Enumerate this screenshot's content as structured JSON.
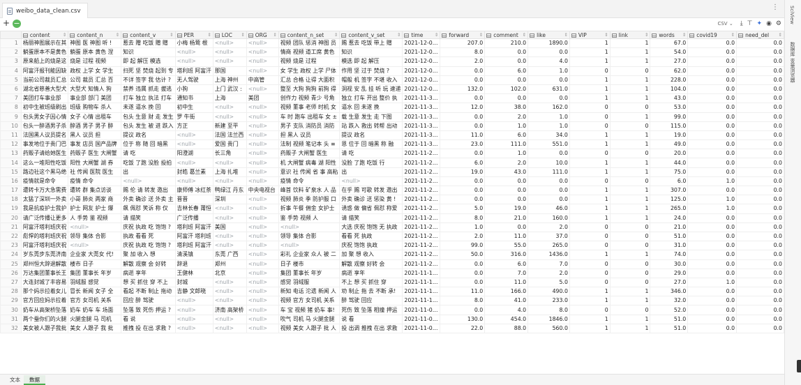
{
  "file_tab": {
    "name": "weibo_data_clean.csv"
  },
  "sidebar": {
    "label_1": "SciView",
    "label_2": "数据库 变量浏览器"
  },
  "toolbar": {
    "format": "CSV ⌄"
  },
  "columns": [
    "content",
    "content_n",
    "content_v",
    "PER",
    "LOC",
    "ORG",
    "content_n_set",
    "content_v_set",
    "time",
    "forward",
    "comment",
    "like",
    "VIP",
    "link",
    "words",
    "covid19",
    "need_del"
  ],
  "rows": [
    [
      "1",
      "杨丽神图展示在其",
      "神图 医 神图 听 !",
      "惹去 赠 吃饭 赠 赠",
      "小梅 杨莺 根",
      "<null>",
      "<null>",
      "视频 团队 惩消 神图 员",
      "赐 惹去 吃饭 带上 赠",
      "2021-12-0…",
      "207.0",
      "210.0",
      "1890.0",
      "1",
      "1",
      "67.0",
      "0.0",
      "0.0"
    ],
    [
      "2",
      "躺蛋原本不是黄色",
      "躺蛋 原本 黄色 涅",
      "知识",
      "<null>",
      "<null>",
      "<null>",
      "情商 视频 道工席 黄色",
      "知识",
      "2021-12-0…",
      "8.0",
      "0.0",
      "0.0",
      "1",
      "1",
      "54.0",
      "0.0",
      "0.0"
    ],
    [
      "3",
      "原来船上的烧是这",
      "烧是 过程 视频",
      "即 起 解压 模选",
      "<null>",
      "<null>",
      "<null>",
      "视频 烧是 过程",
      "模选 即 起 解压",
      "2021-12-0…",
      "2.0",
      "0.0",
      "4.0",
      "1",
      "1",
      "27.0",
      "0.0",
      "0.0"
    ],
    [
      "4",
      "阿富汗报刊能因缺",
      "政权 上学 女 学生",
      "扫死 坚 焚烧 起到 专",
      "塔利班 阿富汗",
      "那国",
      "<null>",
      "女 学生 政权 上学 尸体",
      "作用 坚 过于 焚烧 ?",
      "2021-12-0…",
      "0.0",
      "6.0",
      "1.0",
      "0",
      "0",
      "62.0",
      "0.0",
      "0.0"
    ],
    [
      "5",
      "当前公司裁员汇总",
      "公司 裁员 汇总 百",
      "不详 签字 我 估计 ?",
      "无人驾驶",
      "上海 神州",
      "中高管",
      "汇总 合格 让得 大面积",
      "帽般 机 签字 不堪 收入",
      "2021-12-0…",
      "0.0",
      "0.0",
      "0.0",
      "1",
      "1",
      "228.0",
      "0.0",
      "0.0"
    ],
    [
      "6",
      "湖北省慈善大型犬",
      "大型犬 知情人 狗",
      "禁养 违属 抓走 拔逃",
      "小狗",
      "上门 武汉 :",
      "<null>",
      "整至 大狗 狗狗 前狗 得",
      "洞视 安 乱 挂 听 玩 速递",
      "2021-12-0…",
      "132.0",
      "102.0",
      "631.0",
      "1",
      "1",
      "104.0",
      "0.0",
      "0.0"
    ],
    [
      "7",
      "美团打车事业部",
      "事业部 部门 美团",
      "打车 独立 执法 打车",
      "通知书",
      "上海",
      "美团",
      "创作力 视频 青少 号角",
      "独立 打车 开出 整价 执",
      "2021-11-3…",
      "0.0",
      "0.0",
      "0.0",
      "1",
      "1",
      "43.0",
      "0.0",
      "0.0"
    ],
    [
      "8",
      "初中生被班级刷出",
      "班级 购物车 杀人",
      "未遂 逼水 挽 回",
      "初中生",
      "<null>",
      "<null>",
      "视频 董事 老师 时机 女",
      "逼水 回 未遂 挽",
      "2021-11-3…",
      "12.0",
      "38.0",
      "162.0",
      "0",
      "0",
      "53.0",
      "0.0",
      "0.0"
    ],
    [
      "9",
      "包头男女子因心情",
      "女子 心情 出租车",
      "包头 生意 财 走 发生",
      "罗 牛街",
      "<null>",
      "<null>",
      "车 时 跑车 出租车 女 ±",
      "载 生意 发生 走 下图",
      "2021-11-3…",
      "0.0",
      "2.0",
      "1.0",
      "0",
      "1",
      "99.0",
      "0.0",
      "0.0"
    ],
    [
      "10",
      "包头一醉酒男子杀",
      "醉酒 男子 男子 醉",
      "包头 发生 被 进 跌入",
      "方正",
      "新建 至平",
      "<null>",
      "男子 支队 消防员 消防",
      "站 跌入 救出 转帮 出动",
      "2021-11-3…",
      "0.0",
      "1.0",
      "1.0",
      "0",
      "0",
      "115.0",
      "0.0",
      "0.0"
    ],
    [
      "11",
      "法国黑人议员提名",
      "黑人 议员 担",
      "提议 政名",
      "<null>",
      "法国 法兰西",
      "<null>",
      "担 黑人 议员",
      "提议 政名",
      "2021-11-3…",
      "11.0",
      "6.0",
      "34.0",
      "1",
      "1",
      "19.0",
      "0.0",
      "0.0"
    ],
    [
      "12",
      "事发地位于贵门巴",
      "事发 店员 国产品牌",
      "位于 称 随 回 暗黑",
      "<null>",
      "爱国 贵门",
      "<null>",
      "法制 视频 笔记本 头 ≡",
      "恩 位于 回 暗黑 称 融",
      "2021-11-3…",
      "23.0",
      "111.0",
      "551.0",
      "1",
      "1",
      "49.0",
      "0.0",
      "0.0"
    ],
    [
      "13",
      "药贩子请给她医生",
      "药贩子 医生 大闸蟹",
      "请 吃",
      "阳澄湖",
      "长三角",
      "<null>",
      "药贩子 大闸蟹 医生",
      "请 吃",
      "2021-11-2…",
      "0.0",
      "1.0",
      "0.0",
      "0",
      "0",
      "20.0",
      "0.0",
      "0.0"
    ],
    [
      "14",
      "这么一堆阳性吃饭",
      "阳性 大闸蟹 湖 券",
      "吃饭 了跑 没脸 投拍",
      "<null>",
      "<null>",
      "<null>",
      "机 大闸蟹 病毒 湖 阳性",
      "没脸 了跑 吃饭 行",
      "2021-11-2…",
      "6.0",
      "2.0",
      "10.0",
      "1",
      "1",
      "44.0",
      "0.0",
      "0.0"
    ],
    [
      "15",
      "路边社这个黑马绝",
      "社 传闻 医院 医生",
      "出",
      "封皓 葛兰素",
      "上海 扎堆",
      "<null>",
      "意识 社 传闻 省 事 高粘",
      "出",
      "2021-11-2…",
      "19.0",
      "43.0",
      "111.0",
      "1",
      "1",
      "75.0",
      "0.0",
      "0.0"
    ],
    [
      "16",
      "疫情就是命令",
      "疫情 命令",
      "<null>",
      "<null>",
      "<null>",
      "<null>",
      "疫情 命令",
      "<null>",
      "2021-11-2…",
      "0.0",
      "0.0",
      "0.0",
      "0",
      "0",
      "6.0",
      "1.0",
      "0.0"
    ],
    [
      "17",
      "遭转卡万大急需费",
      "遭转 群 集点访谈",
      "赐 伦 请 转发 邀出",
      "康师傅 冰红茶",
      "鸭绿江 丹东",
      "中央电视台",
      "峰首 饮料 矿泉水 人 品",
      "在乎 赐 可歌 转发 邀出",
      "2021-11-2…",
      "0.0",
      "0.0",
      "0.0",
      "1",
      "1",
      "307.0",
      "0.0",
      "0.0"
    ],
    [
      "18",
      "太猛了深圳一外卖",
      "小哥 肺炎 两家 商",
      "外卖 确诊 送 外卖 主",
      "晋晋",
      "深圳",
      "<null>",
      "视频 肺炎 季 防护服 口",
      "外卖 确诊 送 惩染 黄 !",
      "2021-11-2…",
      "0.0",
      "0.0",
      "0.0",
      "1",
      "1",
      "125.0",
      "1.0",
      "0.0"
    ],
    [
      "19",
      "我是抗疫护士我护",
      "护士 网友 护士 爆",
      "飙 佩怼 笑诉 称 仅",
      "吉林长春 莆恒",
      "<null>",
      "<null>",
      "折事 午餐 佣金 女护士",
      "诱惑 做 偏省 佩怼 称爱",
      "2021-11-2…",
      "5.0",
      "19.0",
      "46.0",
      "1",
      "1",
      "265.0",
      "1.0",
      "0.0"
    ],
    [
      "20",
      "请广泛传播让更多",
      "人 手势 鉴 视频",
      "请 描笑",
      "广泛传播",
      "<null>",
      "<null>",
      "鉴 手势 视频 人",
      "请 描笑",
      "2021-11-2…",
      "8.0",
      "21.0",
      "160.0",
      "1",
      "1",
      "24.0",
      "0.0",
      "0.0"
    ],
    [
      "21",
      "阿富汗塔利班庆祝",
      "<null>",
      "庆祝 执政 吃 饱饱 ?",
      "塔利班 阿富汗",
      "美国",
      "<null>",
      "<null>",
      "大选 庆祝 饱饱 无 执政",
      "2021-11-2…",
      "1.0",
      "0.0",
      "2.0",
      "0",
      "0",
      "21.0",
      "0.0",
      "0.0"
    ],
    [
      "22",
      "彪悍的塔利班庆祝",
      "领导 集体 合影",
      "执政 看看 死",
      "阿富汗 塔利班",
      "<null>",
      "<null>",
      "领导 集体 合影",
      "看看 死 执政",
      "2021-11-2…",
      "2.0",
      "11.0",
      "37.0",
      "0",
      "0",
      "51.0",
      "0.0",
      "0.0"
    ],
    [
      "23",
      "阿富汗塔利班庆祝",
      "<null>",
      "庆祝 执政 吃 饱饱 ?",
      "塔利班 阿富汗",
      "<null>",
      "<null>",
      "<null>",
      "庆祝 饱饱 执政",
      "2021-11-2…",
      "99.0",
      "55.0",
      "265.0",
      "0",
      "0",
      "31.0",
      "0.0",
      "0.0"
    ],
    [
      "24",
      "岁东莞步东莞济南",
      "企业家 大莞女 代!",
      "聚 加 收入 想",
      "清溪镇",
      "东莞 广西",
      "<null>",
      "彩礼 企业家 众人 被 二",
      "加 聚 想 收入",
      "2021-11-2…",
      "50.0",
      "316.0",
      "1436.0",
      "1",
      "1",
      "74.0",
      "0.0",
      "0.0"
    ],
    [
      "25",
      "郑州恒大辞退解散",
      "楼市 日子",
      "解散 观察 会 好转",
      "辞退",
      "郑州",
      "<null>",
      "日子 楼市",
      "解散 观察 好转 会",
      "2021-11-2…",
      "0.0",
      "6.0",
      "7.0",
      "0",
      "0",
      "30.0",
      "0.0",
      "0.0"
    ],
    [
      "26",
      "万达集团董事长王",
      "集团 董事长 年岁",
      "病逝 享年",
      "王健林",
      "北京",
      "<null>",
      "集团 董事长 年岁",
      "病逝 享年",
      "2021-11-1…",
      "0.0",
      "7.0",
      "2.0",
      "0",
      "0",
      "29.0",
      "0.0",
      "0.0"
    ],
    [
      "27",
      "大连封城了丰容易",
      "羽绒服 感觉",
      "想 买 抓住 穿 不上",
      "封城",
      "<null>",
      "<null>",
      "感觉 羽绒服",
      "不上 想 买 抓住 穿",
      "2021-11-1…",
      "0.0",
      "11.0",
      "5.0",
      "0",
      "0",
      "27.0",
      "1.0",
      "0.0"
    ],
    [
      "28",
      "那个妈示拉着女儿",
      "冒长 新闻 女子 全",
      "看起 不断 制止 拖动",
      "吉静 文郎晓",
      "<null>",
      "<null>",
      "新知 电话 沱遗 新闻 人",
      "劝 制止 拖 去 不断 承!",
      "2021-11-1…",
      "11.0",
      "166.0",
      "490.0",
      "1",
      "1",
      "346.0",
      "0.0",
      "0.0"
    ],
    [
      "29",
      "官方回应妈示拉着",
      "官方 女司机 关系",
      "回应 醉 驾驶",
      "<null>",
      "<null>",
      "<null>",
      "视频 官方 女司机 关系",
      "醉 驾驶 回应",
      "2021-11-1…",
      "8.0",
      "41.0",
      "233.0",
      "1",
      "1",
      "32.0",
      "0.0",
      "0.0"
    ],
    [
      "30",
      "奶车从高架桥坠落",
      "奶车 奶车 车 场面",
      "坠落 致 死伤 押运 ?",
      "<null>",
      "济南 高架桥",
      "<null>",
      "车 宝 视频 猪 奶车 事!",
      "死伤 致 坠落 相撞 押运",
      "2021-11-0…",
      "0.0",
      "4.0",
      "8.0",
      "0",
      "0",
      "52.0",
      "0.0",
      "0.0"
    ],
    [
      "31",
      "两个蚕你们的火腿",
      "火腿金腿 马 司机",
      "看 说",
      "<null>",
      "<null>",
      "<null>",
      "吹气 司机 马 火腿金腿",
      "说 看",
      "2021-11-0…",
      "130.0",
      "454.0",
      "1846.0",
      "1",
      "1",
      "51.0",
      "0.0",
      "0.0"
    ],
    [
      "32",
      "美女被人跟子我批",
      "美女 人跟子 我 批",
      "推拽 投 在出 求救 ?",
      "<null>",
      "<null>",
      "<null>",
      "视频 美女 人跟子 批 人",
      "投 出调 推拽 在出 求救",
      "2021-11-0…",
      "22.0",
      "88.0",
      "560.0",
      "1",
      "1",
      "51.0",
      "0.0",
      "0.0"
    ]
  ],
  "bottom_tabs": {
    "text": "文本",
    "data": "数据"
  }
}
